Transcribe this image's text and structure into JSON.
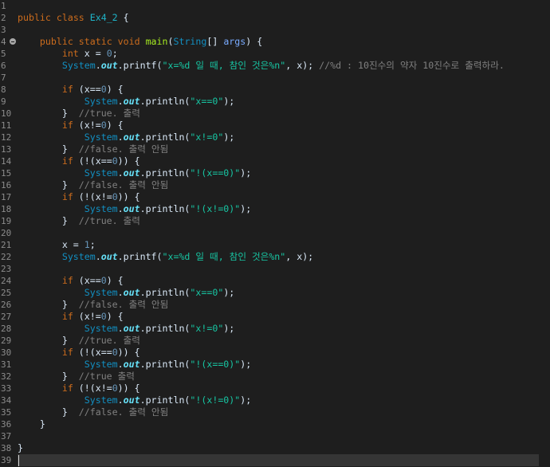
{
  "editor": {
    "current_line": 39,
    "syntax_colors": {
      "default": "#d9e8f7",
      "line_number": "#8c8c8c",
      "keyword": "#cc6c1d",
      "type": "#1290c3",
      "field": "#66e1f8",
      "method_decl": "#a7ec21",
      "class_name": "#1eb5c9",
      "param": "#79abff",
      "number": "#6897bb",
      "string": "#17c6a3",
      "comment": "#808080",
      "current_line_bg": "#353535"
    },
    "lines": [
      {
        "number": "1",
        "code": ""
      },
      {
        "number": "2",
        "code": "public class Ex4_2 {"
      },
      {
        "number": "3",
        "code": ""
      },
      {
        "number": "4",
        "code": "    public static void main(String[] args) {",
        "fold_icon": "minus-circle-icon"
      },
      {
        "number": "5",
        "code": "        int x = 0;"
      },
      {
        "number": "6",
        "code": "        System.out.printf(\"x=%d 일 때, 참인 것은%n\", x); //%d : 10진수의 약자 10진수로 출력하라."
      },
      {
        "number": "7",
        "code": ""
      },
      {
        "number": "8",
        "code": "        if (x==0) {"
      },
      {
        "number": "9",
        "code": "            System.out.println(\"x==0\");"
      },
      {
        "number": "10",
        "code": "        }  //true. 출력"
      },
      {
        "number": "11",
        "code": "        if (x!=0) {"
      },
      {
        "number": "12",
        "code": "            System.out.println(\"x!=0\");"
      },
      {
        "number": "13",
        "code": "        }  //false. 출력 안됨"
      },
      {
        "number": "14",
        "code": "        if (!(x==0)) {"
      },
      {
        "number": "15",
        "code": "            System.out.println(\"!(x==0)\");"
      },
      {
        "number": "16",
        "code": "        }  //false. 출력 안됨"
      },
      {
        "number": "17",
        "code": "        if (!(x!=0)) {"
      },
      {
        "number": "18",
        "code": "            System.out.println(\"!(x!=0)\");"
      },
      {
        "number": "19",
        "code": "        }  //true. 출력"
      },
      {
        "number": "20",
        "code": ""
      },
      {
        "number": "21",
        "code": "        x = 1;"
      },
      {
        "number": "22",
        "code": "        System.out.printf(\"x=%d 일 때, 참인 것은%n\", x);"
      },
      {
        "number": "23",
        "code": ""
      },
      {
        "number": "24",
        "code": "        if (x==0) {"
      },
      {
        "number": "25",
        "code": "            System.out.println(\"x==0\");"
      },
      {
        "number": "26",
        "code": "        }  //false. 출력 안됨"
      },
      {
        "number": "27",
        "code": "        if (x!=0) {"
      },
      {
        "number": "28",
        "code": "            System.out.println(\"x!=0\");"
      },
      {
        "number": "29",
        "code": "        }  //true. 출력"
      },
      {
        "number": "30",
        "code": "        if (!(x==0)) {"
      },
      {
        "number": "31",
        "code": "            System.out.println(\"!(x==0)\");"
      },
      {
        "number": "32",
        "code": "        }  //true 출력"
      },
      {
        "number": "33",
        "code": "        if (!(x!=0)) {"
      },
      {
        "number": "34",
        "code": "            System.out.println(\"!(x!=0)\");"
      },
      {
        "number": "35",
        "code": "        }  //false. 출력 안됨"
      },
      {
        "number": "36",
        "code": "    }"
      },
      {
        "number": "37",
        "code": ""
      },
      {
        "number": "38",
        "code": "}"
      },
      {
        "number": "39",
        "code": ""
      }
    ]
  }
}
